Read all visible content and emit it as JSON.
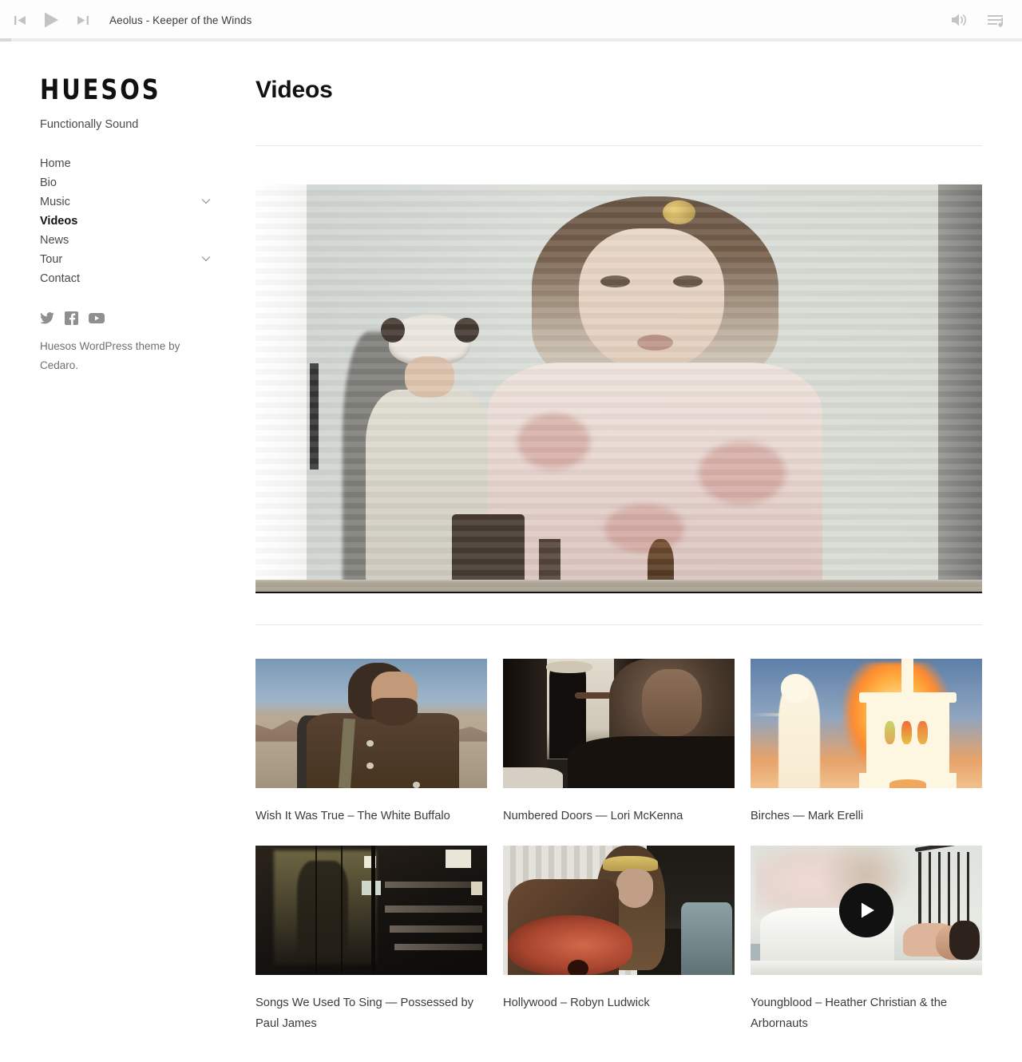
{
  "player": {
    "prev_label": "Previous track",
    "play_label": "Play",
    "next_label": "Next track",
    "track_title": "Aeolus - Keeper of the Winds",
    "volume_label": "Volume",
    "playlist_label": "Playlist"
  },
  "sidebar": {
    "logo": "HUESOS",
    "tagline": "Functionally Sound",
    "nav": [
      {
        "label": "Home",
        "active": false,
        "submenu": false
      },
      {
        "label": "Bio",
        "active": false,
        "submenu": false
      },
      {
        "label": "Music",
        "active": false,
        "submenu": true
      },
      {
        "label": "Videos",
        "active": true,
        "submenu": false
      },
      {
        "label": "News",
        "active": false,
        "submenu": false
      },
      {
        "label": "Tour",
        "active": false,
        "submenu": true
      },
      {
        "label": "Contact",
        "active": false,
        "submenu": false
      }
    ],
    "socials": [
      {
        "name": "twitter-icon",
        "label": "Twitter"
      },
      {
        "name": "facebook-icon",
        "label": "Facebook"
      },
      {
        "name": "youtube-icon",
        "label": "YouTube"
      }
    ],
    "credit": "Huesos WordPress theme by Cedaro."
  },
  "main": {
    "page_title": "Videos",
    "featured": {
      "alt": "Woman projected on wall with person in animal hat"
    },
    "videos": [
      {
        "title": "Wish It Was True – The White Buffalo",
        "playing": false
      },
      {
        "title": "Numbered Doors — Lori McKenna",
        "playing": false
      },
      {
        "title": "Birches — Mark Erelli",
        "playing": false
      },
      {
        "title": "Songs We Used To Sing — Possessed by Paul James",
        "playing": false
      },
      {
        "title": "Hollywood – Robyn Ludwick",
        "playing": false
      },
      {
        "title": "Youngblood – Heather Christian & the Arbornauts",
        "playing": true
      }
    ]
  },
  "colors": {
    "text": "#3b3b3b",
    "heading": "#111111",
    "rule": "#e6e6e6",
    "icon_grey": "#c8c8c8",
    "social_grey": "#8a8a8a",
    "overlay": "#111111"
  }
}
